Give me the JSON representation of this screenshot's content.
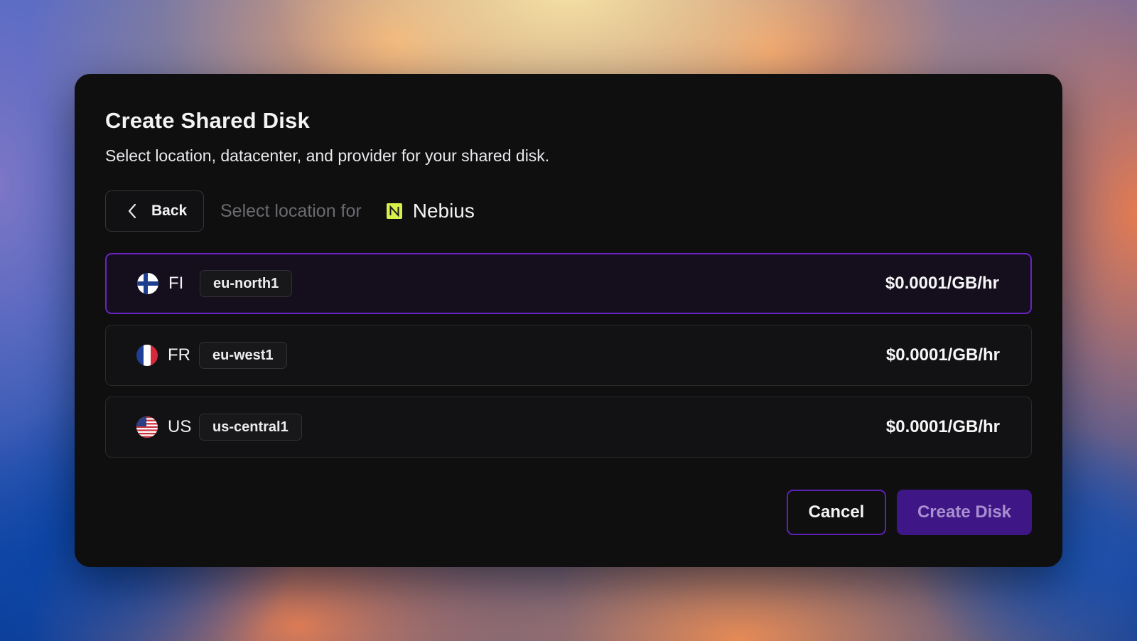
{
  "dialog": {
    "title": "Create Shared Disk",
    "subtitle": "Select location, datacenter, and provider for your shared disk."
  },
  "nav": {
    "back_label": "Back",
    "back_icon": "chevron-left-icon",
    "select_location_for": "Select location for",
    "provider": {
      "name": "Nebius",
      "logo_icon": "nebius-logo-icon",
      "logo_color": "#d8f04a"
    }
  },
  "locations": [
    {
      "code": "FI",
      "region": "eu-north1",
      "price": "$0.0001/GB/hr",
      "flag_icon": "finland-flag-icon",
      "selected": true
    },
    {
      "code": "FR",
      "region": "eu-west1",
      "price": "$0.0001/GB/hr",
      "flag_icon": "france-flag-icon",
      "selected": false
    },
    {
      "code": "US",
      "region": "us-central1",
      "price": "$0.0001/GB/hr",
      "flag_icon": "usa-flag-icon",
      "selected": false
    }
  ],
  "footer": {
    "cancel_label": "Cancel",
    "create_label": "Create Disk"
  },
  "colors": {
    "accent": "#6a22c9",
    "primary_button": "#3f1686",
    "dialog_background": "#0f0f10"
  }
}
